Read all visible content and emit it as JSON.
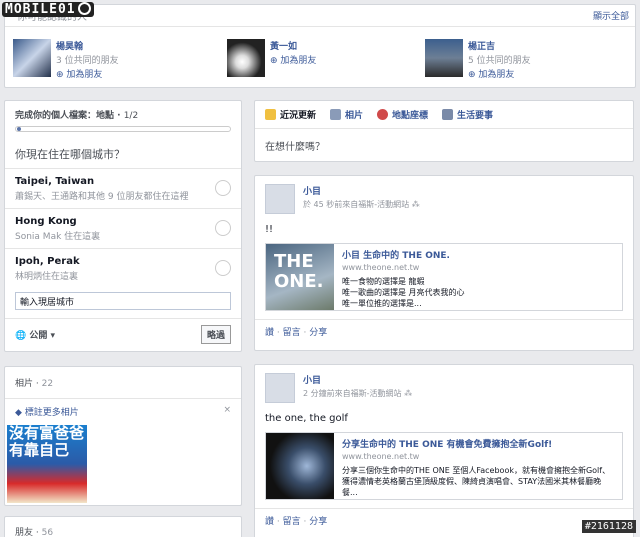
{
  "pymk": {
    "title": "你可能認識的人",
    "show_all": "顯示全部",
    "people": [
      {
        "name": "楊昊翰",
        "mutual": "3 位共同的朋友",
        "add": "加為朋友"
      },
      {
        "name": "黃一如",
        "mutual": "",
        "add": "加為朋友"
      },
      {
        "name": "楊正吉",
        "mutual": "5 位共同的朋友",
        "add": "加為朋友"
      }
    ]
  },
  "profile": {
    "title": "完成你的個人檔案：地點",
    "progress": "1/2",
    "progress_fraction": 0.02,
    "question": "你現在住在哪個城市？",
    "cities": [
      {
        "city": "Taipei, Taiwan",
        "sub": "蕭錫天、王通路和其他 9 位朋友都住在這裡"
      },
      {
        "city": "Hong Kong",
        "sub": "Sonia Mak 住在這裏"
      },
      {
        "city": "Ipoh, Perak",
        "sub": "林明炳住在這裏"
      }
    ],
    "input_value": "輸入現居城市",
    "privacy": "公開",
    "skip": "略過"
  },
  "photos": {
    "title": "相片",
    "count": "22",
    "tag_more": "標註更多相片",
    "close": "×",
    "thumb_text": "沒有富爸爸 有靠自己"
  },
  "friends": {
    "title": "朋友",
    "count": "56"
  },
  "composer": {
    "tabs": [
      "近況更新",
      "相片",
      "地點座標",
      "生活要事"
    ],
    "placeholder": "在想什麼嗎？"
  },
  "posts": [
    {
      "author": "小目",
      "meta": "於 45 秒前來自福斯-活動網站",
      "text": "!!",
      "share_title": "小目 生命中的 THE ONE.",
      "share_url": "www.theone.net.tw",
      "share_desc": "唯一食物的選擇是 龍蝦\n唯一歌曲的選擇是 月亮代表我的心\n唯一單位推的選擇是...",
      "share_img_text": "THE ONE.",
      "actions": [
        "讚",
        "留言",
        "分享"
      ]
    },
    {
      "author": "小目",
      "meta": "2 分鐘前來自福斯-活動網站",
      "text": "the one, the golf",
      "share_title": "分享生命中的 THE ONE 有機會免費擁抱全新Golf!",
      "share_url": "www.theone.net.tw",
      "share_desc": "分享三個你生命中的THE ONE 至個人Facebook，就有機會擁抱全新Golf、獲得濃情老英格蘭古堡頂級度假、陳綺貞演唱會、STAY法國米其林餐廳晚餐...",
      "share_img_text": "",
      "actions": [
        "讚",
        "留言",
        "分享"
      ]
    }
  ],
  "watermark": "MOBILE01",
  "stamp": "#2161128"
}
